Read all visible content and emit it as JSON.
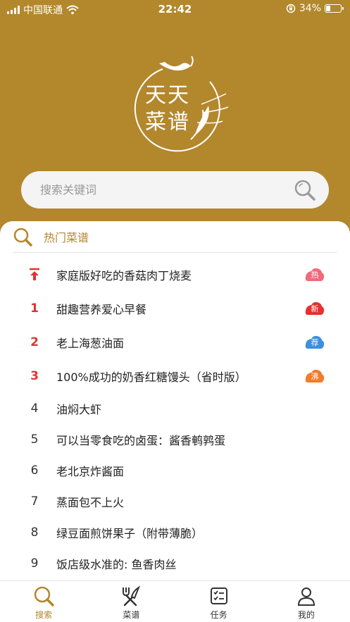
{
  "status_bar": {
    "carrier": "中国联通",
    "time": "22:42",
    "battery": "34%",
    "battery_level": 0.34
  },
  "logo": {
    "line1": "天天",
    "line2": "菜谱"
  },
  "search": {
    "placeholder": "搜索关键词"
  },
  "hot": {
    "title": "热门菜谱",
    "items": [
      {
        "rank": "",
        "title": "家庭版好吃的香菇肉丁烧麦",
        "badge": "热",
        "badge_color": "#f06a7a"
      },
      {
        "rank": "1",
        "title": "甜趣营养爱心早餐",
        "badge": "新",
        "badge_color": "#e5312f"
      },
      {
        "rank": "2",
        "title": "老上海葱油面",
        "badge": "荐",
        "badge_color": "#3a8fe0"
      },
      {
        "rank": "3",
        "title": "100%成功的奶香红糖馒头（省时版）",
        "badge": "沸",
        "badge_color": "#f07c2c"
      },
      {
        "rank": "4",
        "title": "油焖大虾"
      },
      {
        "rank": "5",
        "title": "可以当零食吃的卤蛋：酱香鹌鹑蛋"
      },
      {
        "rank": "6",
        "title": "老北京炸酱面"
      },
      {
        "rank": "7",
        "title": "蒸面包不上火"
      },
      {
        "rank": "8",
        "title": "绿豆面煎饼果子（附带薄脆）"
      },
      {
        "rank": "9",
        "title": "饭店级水准的: 鱼香肉丝"
      }
    ]
  },
  "tabs": [
    {
      "label": "搜索",
      "icon": "search-icon"
    },
    {
      "label": "菜谱",
      "icon": "fork-knife-icon"
    },
    {
      "label": "任务",
      "icon": "task-list-icon"
    },
    {
      "label": "我的",
      "icon": "user-icon"
    }
  ],
  "colors": {
    "brand": "#b3872c",
    "rank_red": "#e5312f"
  }
}
